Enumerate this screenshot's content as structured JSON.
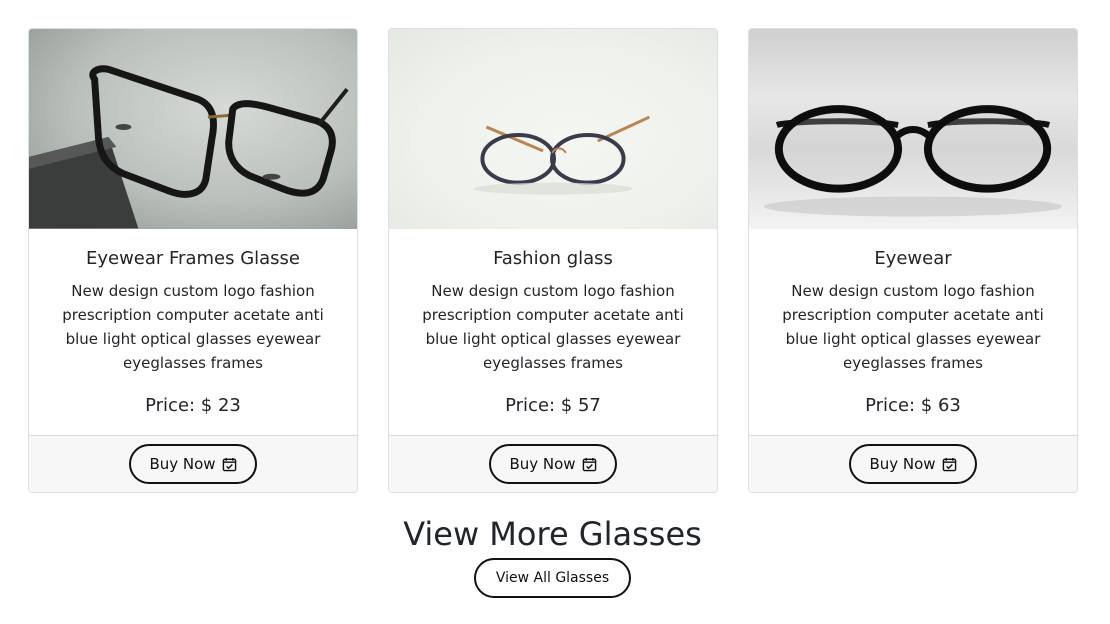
{
  "products": [
    {
      "title": "Eyewear Frames Glasse",
      "description": "New design custom logo fashion prescription computer acetate anti blue light optical glasses eyewear eyeglasses frames",
      "price": "Price: $ 23",
      "buy_label": "Buy Now"
    },
    {
      "title": "Fashion glass",
      "description": "New design custom logo fashion prescription computer acetate anti blue light optical glasses eyewear eyeglasses frames",
      "price": "Price: $ 57",
      "buy_label": "Buy Now"
    },
    {
      "title": "Eyewear",
      "description": "New design custom logo fashion prescription computer acetate anti blue light optical glasses eyewear eyeglasses frames",
      "price": "Price: $ 63",
      "buy_label": "Buy Now"
    }
  ],
  "more_section": {
    "heading": "View More Glasses",
    "button_label": "View All Glasses"
  },
  "icons": {
    "buy_button_icon": "calendar-check-icon"
  },
  "colors": {
    "button_border": "#111111",
    "footer_bg": "#f7f7f7",
    "text": "#212529"
  }
}
